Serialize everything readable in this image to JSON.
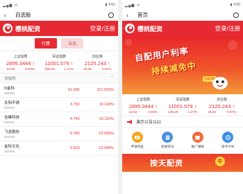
{
  "colors": {
    "accent": "#e52a33",
    "inactive_tab_bg": "#f6dada"
  },
  "left": {
    "status_time": "4:51",
    "nav_title": "自选股",
    "brand": "樱桃配资",
    "login": "登录/注册",
    "tabs": [
      {
        "label": "行情"
      },
      {
        "label": "自选"
      }
    ],
    "indices": [
      {
        "name": "上证指数",
        "value": "2895.3444",
        "change": "23.82",
        "pct": "0.83%"
      },
      {
        "name": "深证指数",
        "value": "11001.579",
        "change": "138.29",
        "pct": "1.27%"
      },
      {
        "name": "创业板",
        "value": "2125.243",
        "change": "18.40",
        "pct": "0.87%"
      }
    ],
    "section": "涨幅榜",
    "stocks": [
      {
        "name": "N金科",
        "code": "688466",
        "price": "52.300",
        "pct": "112.915%"
      },
      {
        "name": "太阳不锈",
        "code": "000825",
        "price": "3.700",
        "pct": "10.119%"
      },
      {
        "name": "吉峰科技",
        "code": "300022",
        "price": "4.790",
        "pct": "10.115%"
      },
      {
        "name": "飞龙股份",
        "code": "002536",
        "price": "5.780",
        "pct": "10.095%"
      },
      {
        "name": "金科文化",
        "code": "300459",
        "price": "2.620",
        "pct": "10.084%"
      }
    ]
  },
  "right": {
    "status_time": "4:50",
    "nav_title": "首页",
    "brand": "樱桃配资",
    "login": "登录/注册",
    "banner": {
      "line1": "自配用户利率",
      "line2": "持续减免中",
      "tag": "活动详情"
    },
    "indices": [
      {
        "name": "上证指数",
        "value": "2895.3444",
        "change": "23.82",
        "pct": "0.83%"
      },
      {
        "name": "深证指数",
        "value": "11001.579",
        "change": "138.29",
        "pct": "1.27%"
      },
      {
        "name": "创业板",
        "value": "2125.243",
        "change": "18.40",
        "pct": "0.87%"
      }
    ],
    "notice": "演示公告1111",
    "quick": [
      {
        "label": "申请资金",
        "color": "#f5a623",
        "icon": "money-icon"
      },
      {
        "label": "新闻资讯",
        "color": "#4a90e2",
        "icon": "news-icon"
      },
      {
        "label": "推广赚钱",
        "color": "#f26b3a",
        "icon": "share-icon"
      },
      {
        "label": "新手引导",
        "color": "#3b8fe6",
        "icon": "guide-icon"
      }
    ],
    "banner2": {
      "title": "按天配资",
      "coin": "牛"
    }
  }
}
